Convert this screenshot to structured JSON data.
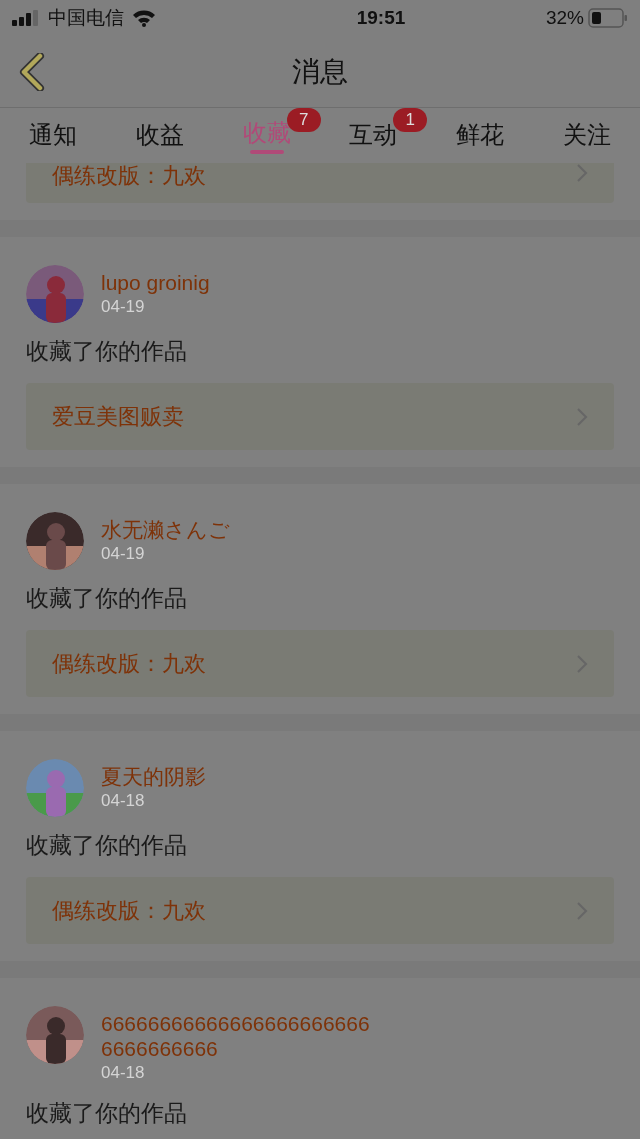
{
  "status_bar": {
    "carrier": "中国电信",
    "time": "19:51",
    "battery": "32%"
  },
  "nav": {
    "title": "消息"
  },
  "tabs": [
    {
      "label": "通知",
      "selected": false
    },
    {
      "label": "收益",
      "selected": false
    },
    {
      "label": "收藏",
      "selected": true,
      "badge": "7"
    },
    {
      "label": "互动",
      "selected": false,
      "badge": "1"
    },
    {
      "label": "鲜花",
      "selected": false
    },
    {
      "label": "关注",
      "selected": false
    }
  ],
  "items": [
    {
      "kind": "partial",
      "link": "偶练改版：九欢"
    },
    {
      "kind": "full",
      "name": "lupo groinig",
      "date": "04-19",
      "action": "收藏了你的作品",
      "link": "爱豆美图贩卖"
    },
    {
      "kind": "full",
      "name": "水无濑さんご",
      "date": "04-19",
      "action": "收藏了你的作品",
      "link": "偶练改版：九欢"
    },
    {
      "kind": "full",
      "name": "夏天的阴影",
      "date": "04-18",
      "action": "收藏了你的作品",
      "link": "偶练改版：九欢"
    },
    {
      "kind": "full",
      "name": "666666666666666666666666666666666",
      "date": "04-18",
      "action": "收藏了你的作品"
    }
  ]
}
